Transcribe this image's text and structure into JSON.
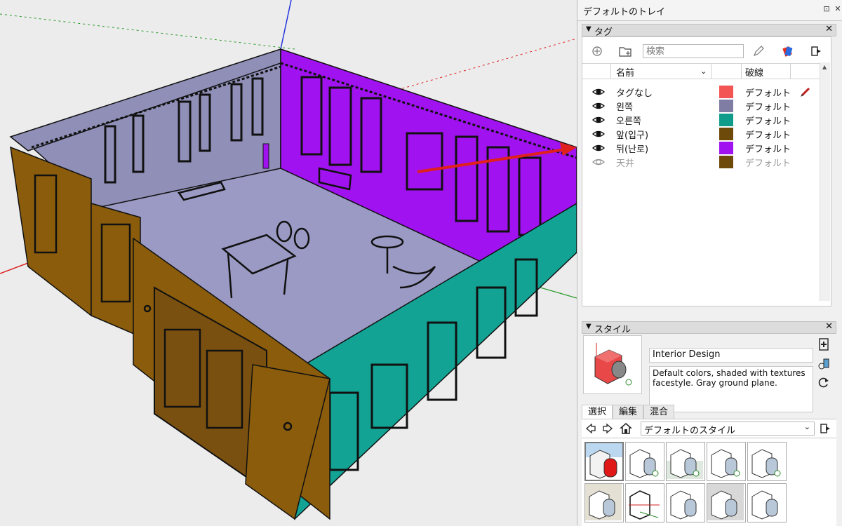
{
  "tray": {
    "title": "デフォルトのトレイ",
    "pin_icon": "pin-icon",
    "close_icon": "close-icon"
  },
  "tags_panel": {
    "title": "タグ",
    "search_placeholder": "検索",
    "columns": {
      "name": "名前",
      "linestyle": "破線"
    },
    "rows": [
      {
        "name": "タグなし",
        "color": "#f35454",
        "linestyle": "デフォルト",
        "visible": true,
        "active": true
      },
      {
        "name": "왼쪽",
        "color": "#7f7da3",
        "linestyle": "デフォルト",
        "visible": true,
        "active": false
      },
      {
        "name": "오른쪽",
        "color": "#0f9c8a",
        "linestyle": "デフォルト",
        "visible": true,
        "active": false
      },
      {
        "name": "앞(입구)",
        "color": "#6e4a0a",
        "linestyle": "デフォルト",
        "visible": true,
        "active": false
      },
      {
        "name": "뒤(난로)",
        "color": "#a012ef",
        "linestyle": "デフォルト",
        "visible": true,
        "active": false
      },
      {
        "name": "天井",
        "color": "#6e4a0a",
        "linestyle": "デフォルト",
        "visible": false,
        "active": false
      }
    ]
  },
  "styles_panel": {
    "title": "スタイル",
    "style_name": "Interior Design",
    "description": "Default colors, shaded with textures facestyle. Gray ground plane.",
    "tabs": [
      "選択",
      "編集",
      "混合"
    ],
    "active_tab": 0,
    "collection": "デフォルトのスタイル"
  },
  "colors": {
    "left_wall": "#8f8fb8",
    "back_wall": "#a012ef",
    "right_wall": "#12a394",
    "front_wall": "#8a5c0c",
    "floor": "#9a9ac4",
    "arrow": "#e0201c"
  }
}
